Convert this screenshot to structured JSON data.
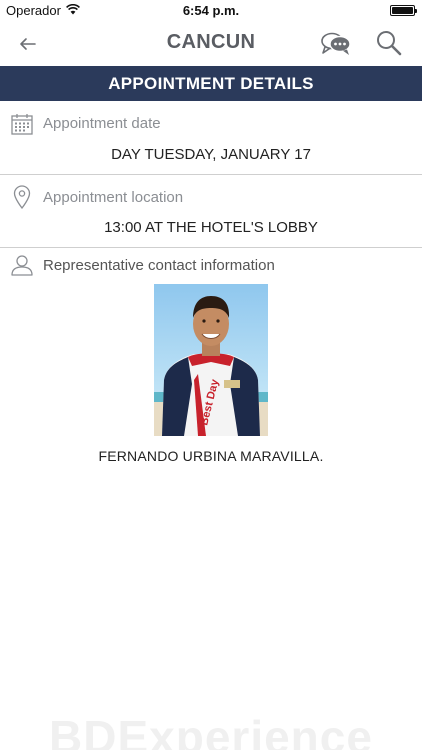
{
  "status_bar": {
    "carrier": "Operador",
    "time": "6:54 p.m.",
    "battery_level": 1.0
  },
  "nav": {
    "title": "CANCUN",
    "back_icon": "back-arrow-icon",
    "chat_icon": "chat-bubbles-icon",
    "search_icon": "search-icon"
  },
  "section": {
    "title": "APPOINTMENT DETAILS",
    "background": "#2b3a5b"
  },
  "appointment_date": {
    "label": "Appointment date",
    "value": "DAY TUESDAY, JANUARY 17",
    "icon": "calendar-icon"
  },
  "appointment_location": {
    "label": "Appointment location",
    "value": "13:00 AT THE HOTEL'S LOBBY",
    "icon": "location-pin-icon"
  },
  "representative": {
    "label": "Representative contact information",
    "icon": "person-icon",
    "shirt_text": "Best Day",
    "name": "FERNANDO URBINA MARAVILLA."
  },
  "footer": {
    "watermark": "BDExperience"
  }
}
